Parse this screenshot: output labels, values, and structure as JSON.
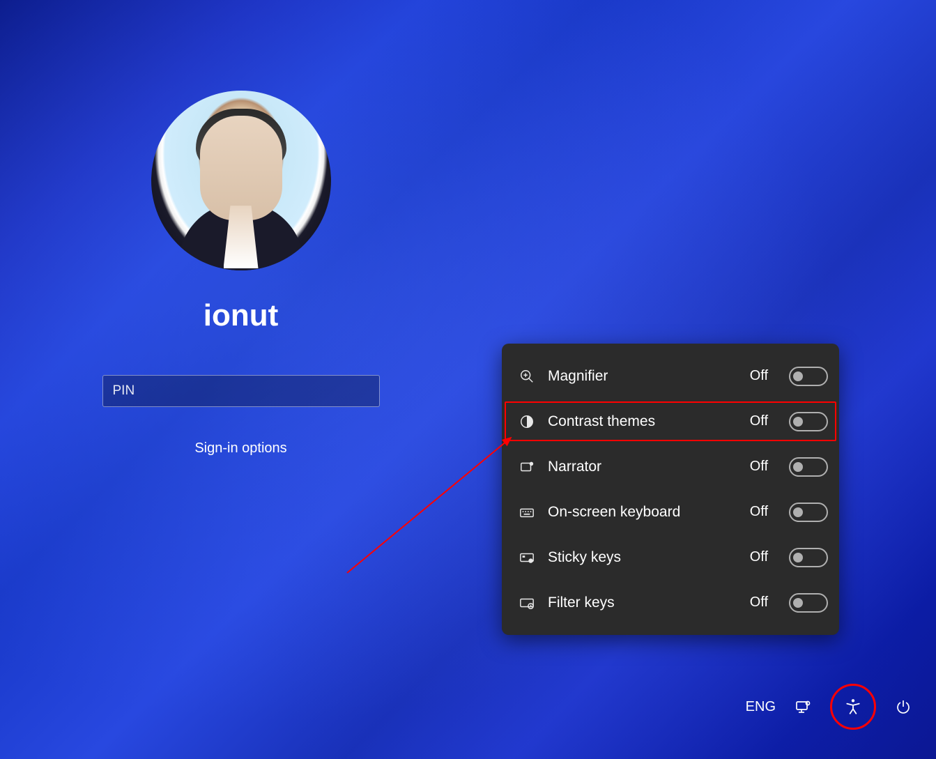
{
  "login": {
    "username": "ionut",
    "pin_placeholder": "PIN",
    "signin_options": "Sign-in options"
  },
  "accessibility": {
    "items": [
      {
        "icon": "magnifier-icon",
        "label": "Magnifier",
        "state": "Off",
        "highlighted": false
      },
      {
        "icon": "contrast-icon",
        "label": "Contrast themes",
        "state": "Off",
        "highlighted": true
      },
      {
        "icon": "narrator-icon",
        "label": "Narrator",
        "state": "Off",
        "highlighted": false
      },
      {
        "icon": "keyboard-icon",
        "label": "On-screen keyboard",
        "state": "Off",
        "highlighted": false
      },
      {
        "icon": "sticky-keys-icon",
        "label": "Sticky keys",
        "state": "Off",
        "highlighted": false
      },
      {
        "icon": "filter-keys-icon",
        "label": "Filter keys",
        "state": "Off",
        "highlighted": false
      }
    ]
  },
  "bottom_bar": {
    "language": "ENG"
  },
  "annotation": {
    "highlight_color": "#ff0000"
  }
}
